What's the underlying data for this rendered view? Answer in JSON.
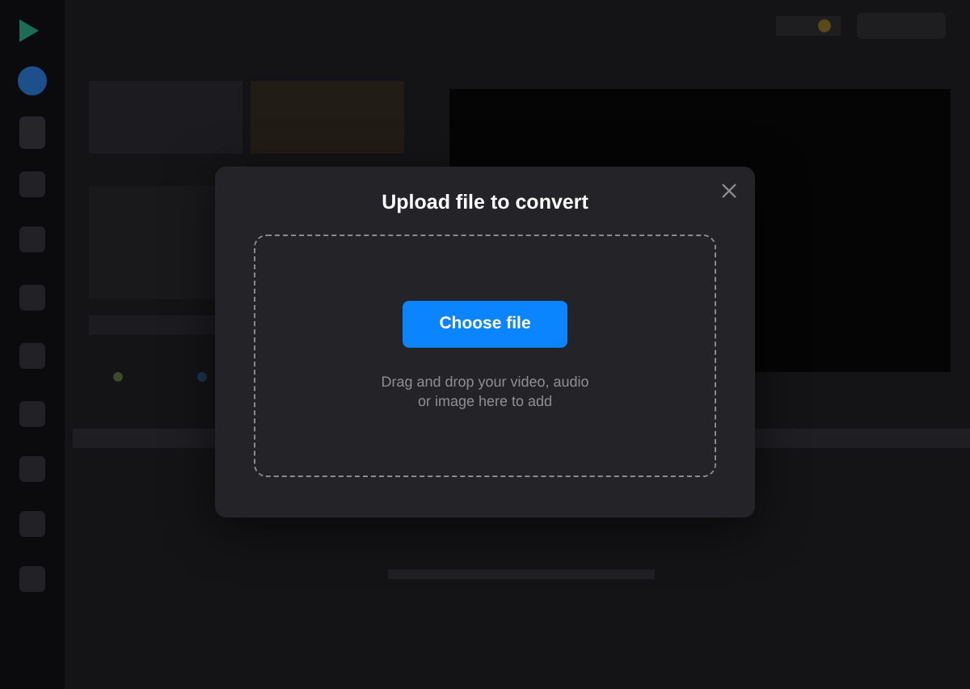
{
  "dialog": {
    "title": "Upload file to convert",
    "dropzone": {
      "button": "Choose file",
      "hint": "Drag and drop your video, audio or image here to add"
    }
  }
}
